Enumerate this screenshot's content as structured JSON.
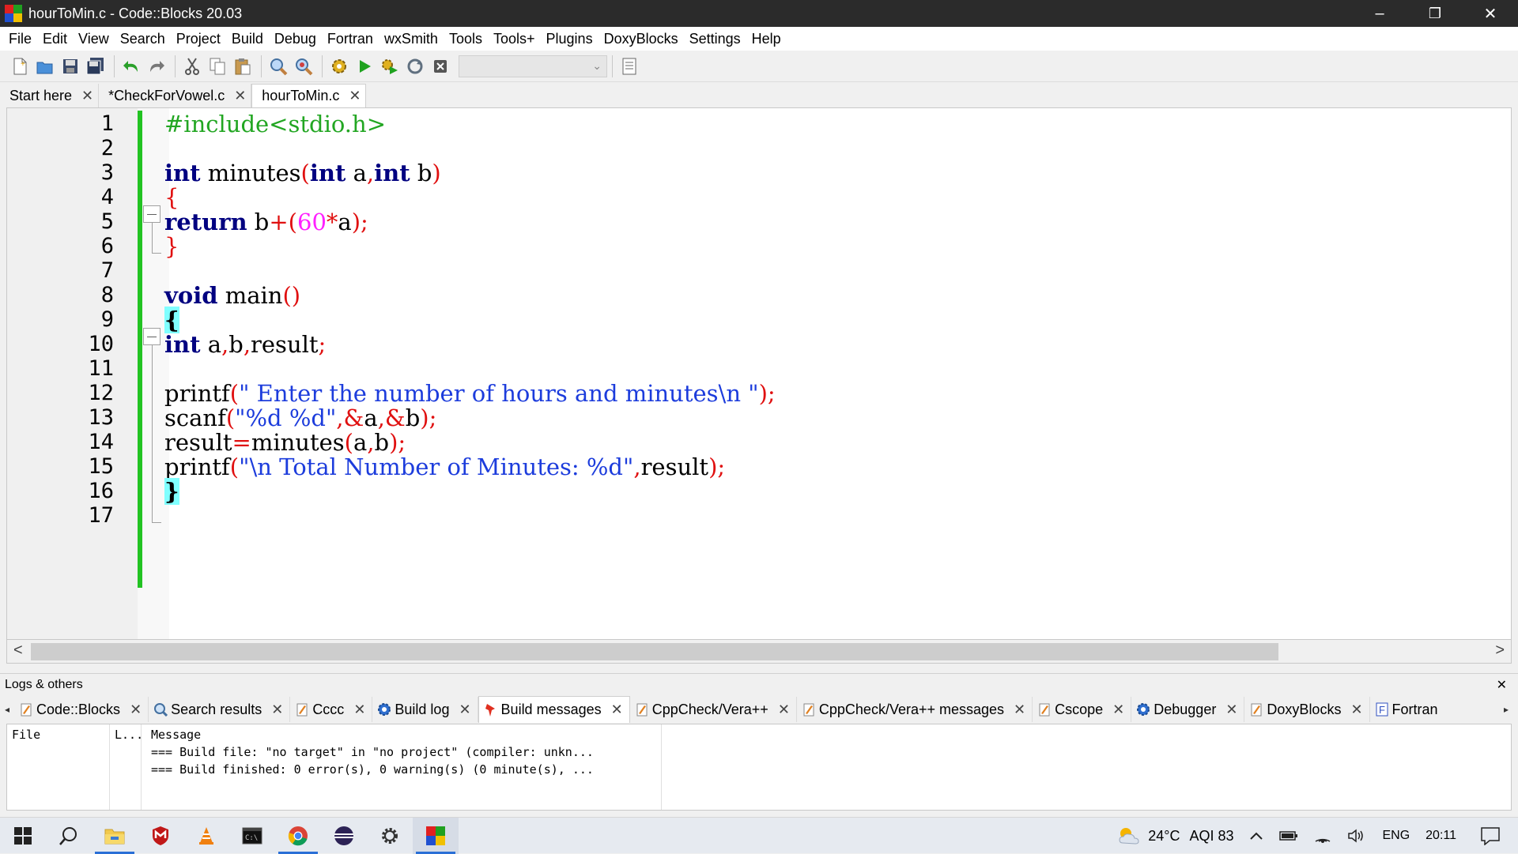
{
  "window": {
    "title": "hourToMin.c - Code::Blocks 20.03",
    "controls": {
      "minimize": "–",
      "maximize": "❐",
      "close": "✕"
    }
  },
  "menu": [
    "File",
    "Edit",
    "View",
    "Search",
    "Project",
    "Build",
    "Debug",
    "Fortran",
    "wxSmith",
    "Tools",
    "Tools+",
    "Plugins",
    "DoxyBlocks",
    "Settings",
    "Help"
  ],
  "toolbar": {
    "buttons": [
      "new-file-icon",
      "open-file-icon",
      "save-icon",
      "save-all-icon",
      "undo-icon",
      "redo-icon",
      "cut-icon",
      "copy-icon",
      "paste-icon",
      "find-icon",
      "replace-icon",
      "build-icon",
      "run-icon",
      "build-and-run-icon",
      "rebuild-icon",
      "abort-icon",
      "target-selector",
      "log-icon"
    ]
  },
  "editor_tabs": [
    {
      "label": "Start here",
      "close": "✕",
      "active": false
    },
    {
      "label": "*CheckForVowel.c",
      "close": "✕",
      "active": false
    },
    {
      "label": "hourToMin.c",
      "close": "✕",
      "active": true
    }
  ],
  "code": {
    "line_numbers": [
      "1",
      "2",
      "3",
      "4",
      "5",
      "6",
      "7",
      "8",
      "9",
      "10",
      "11",
      "12",
      "13",
      "14",
      "15",
      "16",
      "17"
    ],
    "lines": {
      "l1": {
        "pp": "#include<stdio.h>"
      },
      "l3": {
        "k1": "int",
        "t1": " minutes",
        "o1": "(",
        "k2": "int",
        "t2": " a",
        "o2": ",",
        "k3": "int",
        "t3": " b",
        "o3": ")"
      },
      "l4": {
        "o1": "{"
      },
      "l5": {
        "k1": "return",
        "t1": " b",
        "o1": "+(",
        "n1": "60",
        "o2": "*",
        "t2": "a",
        "o3": ");"
      },
      "l6": {
        "o1": "}"
      },
      "l8": {
        "k1": "void",
        "t1": " main",
        "o1": "()"
      },
      "l9": {
        "b1": "{"
      },
      "l10": {
        "k1": "int",
        "t1": " a",
        "o1": ",",
        "t2": "b",
        "o2": ",",
        "t3": "result",
        "o3": ";"
      },
      "l12": {
        "t1": "printf",
        "o1": "(",
        "s1": "\" Enter the number of hours and minutes\\n \"",
        "o2": ");"
      },
      "l13": {
        "t1": "scanf",
        "o1": "(",
        "s1": "\"%d %d\"",
        "o2": ",&",
        "t2": "a",
        "o3": ",&",
        "t3": "b",
        "o4": ");"
      },
      "l14": {
        "t1": "result",
        "o1": "=",
        "t2": "minutes",
        "o2": "(",
        "t3": "a",
        "o3": ",",
        "t4": "b",
        "o4": ");"
      },
      "l15": {
        "t1": "printf",
        "o1": "(",
        "s1": "\"\\n Total Number of Minutes: %d\"",
        "o2": ",",
        "t2": "result",
        "o3": ");"
      },
      "l16": {
        "b1": "}"
      }
    }
  },
  "hscroll": {
    "left": "<",
    "right": ">"
  },
  "logs": {
    "title": "Logs & others",
    "close": "✕",
    "scroll_left": "◂",
    "scroll_right": "▸",
    "tabs": [
      {
        "label": "Code::Blocks",
        "icon": "pencil-icon",
        "close": "✕"
      },
      {
        "label": "Search results",
        "icon": "magnifier-icon",
        "close": "✕"
      },
      {
        "label": "Cccc",
        "icon": "pencil-icon",
        "close": "✕"
      },
      {
        "label": "Build log",
        "icon": "gear-icon",
        "close": "✕"
      },
      {
        "label": "Build messages",
        "icon": "pin-icon",
        "close": "✕",
        "active": true
      },
      {
        "label": "CppCheck/Vera++",
        "icon": "pencil-icon",
        "close": "✕"
      },
      {
        "label": "CppCheck/Vera++ messages",
        "icon": "pencil-icon",
        "close": "✕"
      },
      {
        "label": "Cscope",
        "icon": "pencil-icon",
        "close": "✕"
      },
      {
        "label": "Debugger",
        "icon": "gear-icon",
        "close": "✕"
      },
      {
        "label": "DoxyBlocks",
        "icon": "pencil-icon",
        "close": "✕"
      },
      {
        "label": "Fortran",
        "icon": "fortran-icon",
        "close": ""
      }
    ],
    "columns": [
      "File",
      "L...",
      "Message"
    ],
    "rows": [
      "=== Build file: \"no target\" in \"no project\" (compiler: unkn...",
      "=== Build finished: 0 error(s), 0 warning(s) (0 minute(s), ..."
    ]
  },
  "taskbar": {
    "apps": [
      "windows-start-icon",
      "search-icon",
      "file-explorer-icon",
      "mcafee-icon",
      "vlc-icon",
      "terminal-icon",
      "chrome-icon",
      "eclipse-icon",
      "settings-gear-icon",
      "codeblocks-icon"
    ],
    "weather": "24°C",
    "aqi": "AQI 83",
    "language": "ENG",
    "time": "20:11",
    "tray_up": "^"
  },
  "colors": {
    "keyword": "#000080",
    "preprocessor": "#22a622",
    "operator": "#e01010",
    "number": "#ff20ff",
    "string": "#1c3cdc",
    "brace_highlight": "#80ffff",
    "change_bar": "#22c322"
  }
}
